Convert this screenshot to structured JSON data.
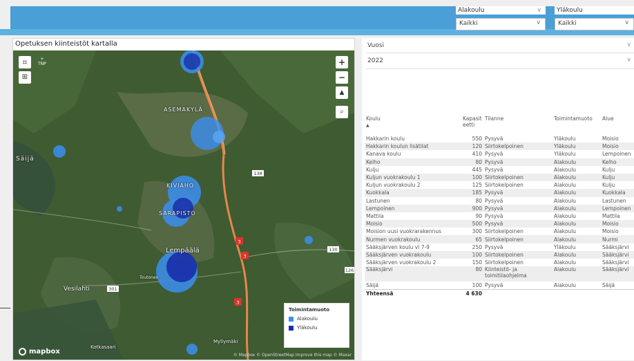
{
  "filters": {
    "alakoulu": {
      "label": "Alakoulu",
      "value": "Kaikki"
    },
    "ylakoulu": {
      "label": "Yläkoulu",
      "value": "Kaikki"
    }
  },
  "map": {
    "title": "Opetuksen kiinteistöt kartalla",
    "tnp_label": "TNP",
    "places": [
      "ASEMAKYLÄ",
      "Säijä",
      "KIVIAHO",
      "SARAPISTO",
      "Lempäälä",
      "Vesilahti",
      "Toutonen",
      "Myllymäki",
      "Kotkasaari"
    ],
    "road_labels": [
      "138",
      "3",
      "3",
      "130",
      "3",
      "301",
      "126"
    ],
    "legend": {
      "title": "Toimintamuoto",
      "items": [
        {
          "label": "Alakoulu",
          "color": "#3b8ff0"
        },
        {
          "label": "Yläkoulu",
          "color": "#1a2fa8"
        }
      ]
    },
    "brand": "mapbox",
    "attribution": "© Mapbox © OpenStreetMap Improve this map © Maxar"
  },
  "table": {
    "year_label": "Vuosi",
    "year_value": "2022",
    "headers": [
      "Koulu",
      "Kapasiteetti",
      "Tilanne",
      "Toimintamuoto",
      "Alue"
    ],
    "rows": [
      [
        "Hakkarin koulu",
        "550",
        "Pysyvä",
        "Yläkoulu",
        "Moisio"
      ],
      [
        "Hakkarin koulun lisätilat",
        "120",
        "Siirtokelpoinen",
        "Yläkoulu",
        "Moisio"
      ],
      [
        "Kanava koulu",
        "410",
        "Pysyvä",
        "Yläkoulu",
        "Lempoinen"
      ],
      [
        "Kelho",
        "80",
        "Pysyvä",
        "Alakoulu",
        "Kelho"
      ],
      [
        "Kulju",
        "445",
        "Pysyvä",
        "Alakoulu",
        "Kulju"
      ],
      [
        "Kuljun vuokrakoulu 1",
        "100",
        "Siirtokelpoinen",
        "Alakoulu",
        "Kulju"
      ],
      [
        "Kuljun vuokrakoulu 2",
        "125",
        "Siirtokelpoinen",
        "Alakoulu",
        "Kulju"
      ],
      [
        "Kuokkala",
        "185",
        "Pysyvä",
        "Alakoulu",
        "Kuokkala"
      ],
      [
        "Lastunen",
        "80",
        "Pysyvä",
        "Alakoulu",
        "Lastunen"
      ],
      [
        "Lempoinen",
        "900",
        "Pysyvä",
        "Alakoulu",
        "Lempoinen"
      ],
      [
        "Mattila",
        "90",
        "Pysyvä",
        "Alakoulu",
        "Mattila"
      ],
      [
        "Moisio",
        "500",
        "Pysyvä",
        "Alakoulu",
        "Moisio"
      ],
      [
        "Moision uusi vuokrarakennus",
        "300",
        "Siirtokelpoinen",
        "Alakoulu",
        "Moisio"
      ],
      [
        "Nurmen vuokrakoulu",
        "65",
        "Siirtokelpoinen",
        "Alakoulu",
        "Nurmi"
      ],
      [
        "Sääksjärven koulu vl 7-9",
        "250",
        "Pysyvä",
        "Yläkoulu",
        "Sääksjärvi"
      ],
      [
        "Sääksjärven vuokrakoulu",
        "100",
        "Siirtokelpoinen",
        "Alakoulu",
        "Sääksjärvi"
      ],
      [
        "Sääksjärven vuokrakoulu 2",
        "150",
        "Siirtokelpoinen",
        "Alakoulu",
        "Sääksjärvi"
      ],
      [
        "Sääksjärvi",
        "80",
        "Kiinteistö- ja toimitilaohjelma",
        "Alakoulu",
        "Sääksjärvi"
      ],
      [
        "Säijä",
        "100",
        "Pysyvä",
        "Alakoulu",
        "Säijä"
      ]
    ],
    "total_label": "Yhteensä",
    "total_value": "4 630"
  }
}
